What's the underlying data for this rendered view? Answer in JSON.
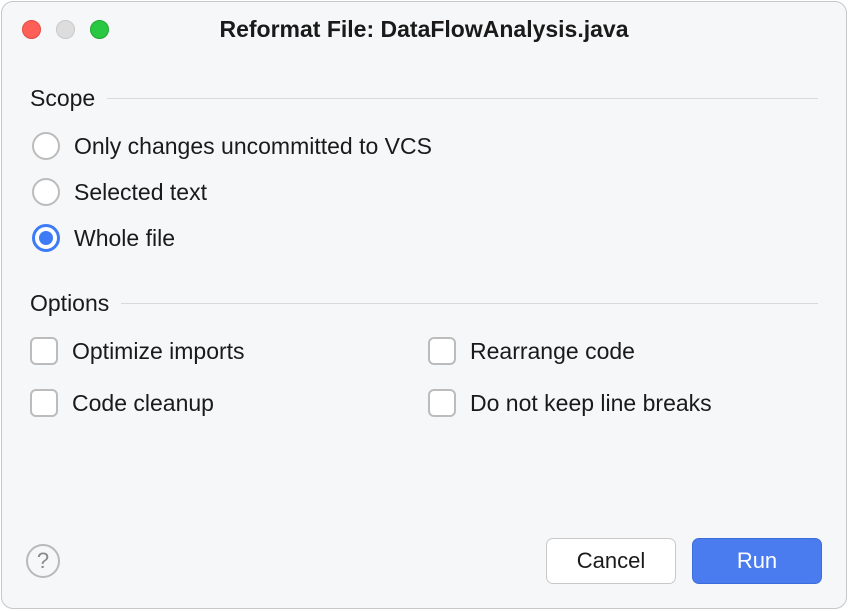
{
  "title": "Reformat File: DataFlowAnalysis.java",
  "scope": {
    "label": "Scope",
    "options": [
      {
        "label": "Only changes uncommitted to VCS",
        "selected": false
      },
      {
        "label": "Selected text",
        "selected": false
      },
      {
        "label": "Whole file",
        "selected": true
      }
    ]
  },
  "options": {
    "label": "Options",
    "items": [
      {
        "label": "Optimize imports",
        "checked": false
      },
      {
        "label": "Rearrange code",
        "checked": false
      },
      {
        "label": "Code cleanup",
        "checked": false
      },
      {
        "label": "Do not keep line breaks",
        "checked": false
      }
    ]
  },
  "buttons": {
    "help": "?",
    "cancel": "Cancel",
    "run": "Run"
  }
}
